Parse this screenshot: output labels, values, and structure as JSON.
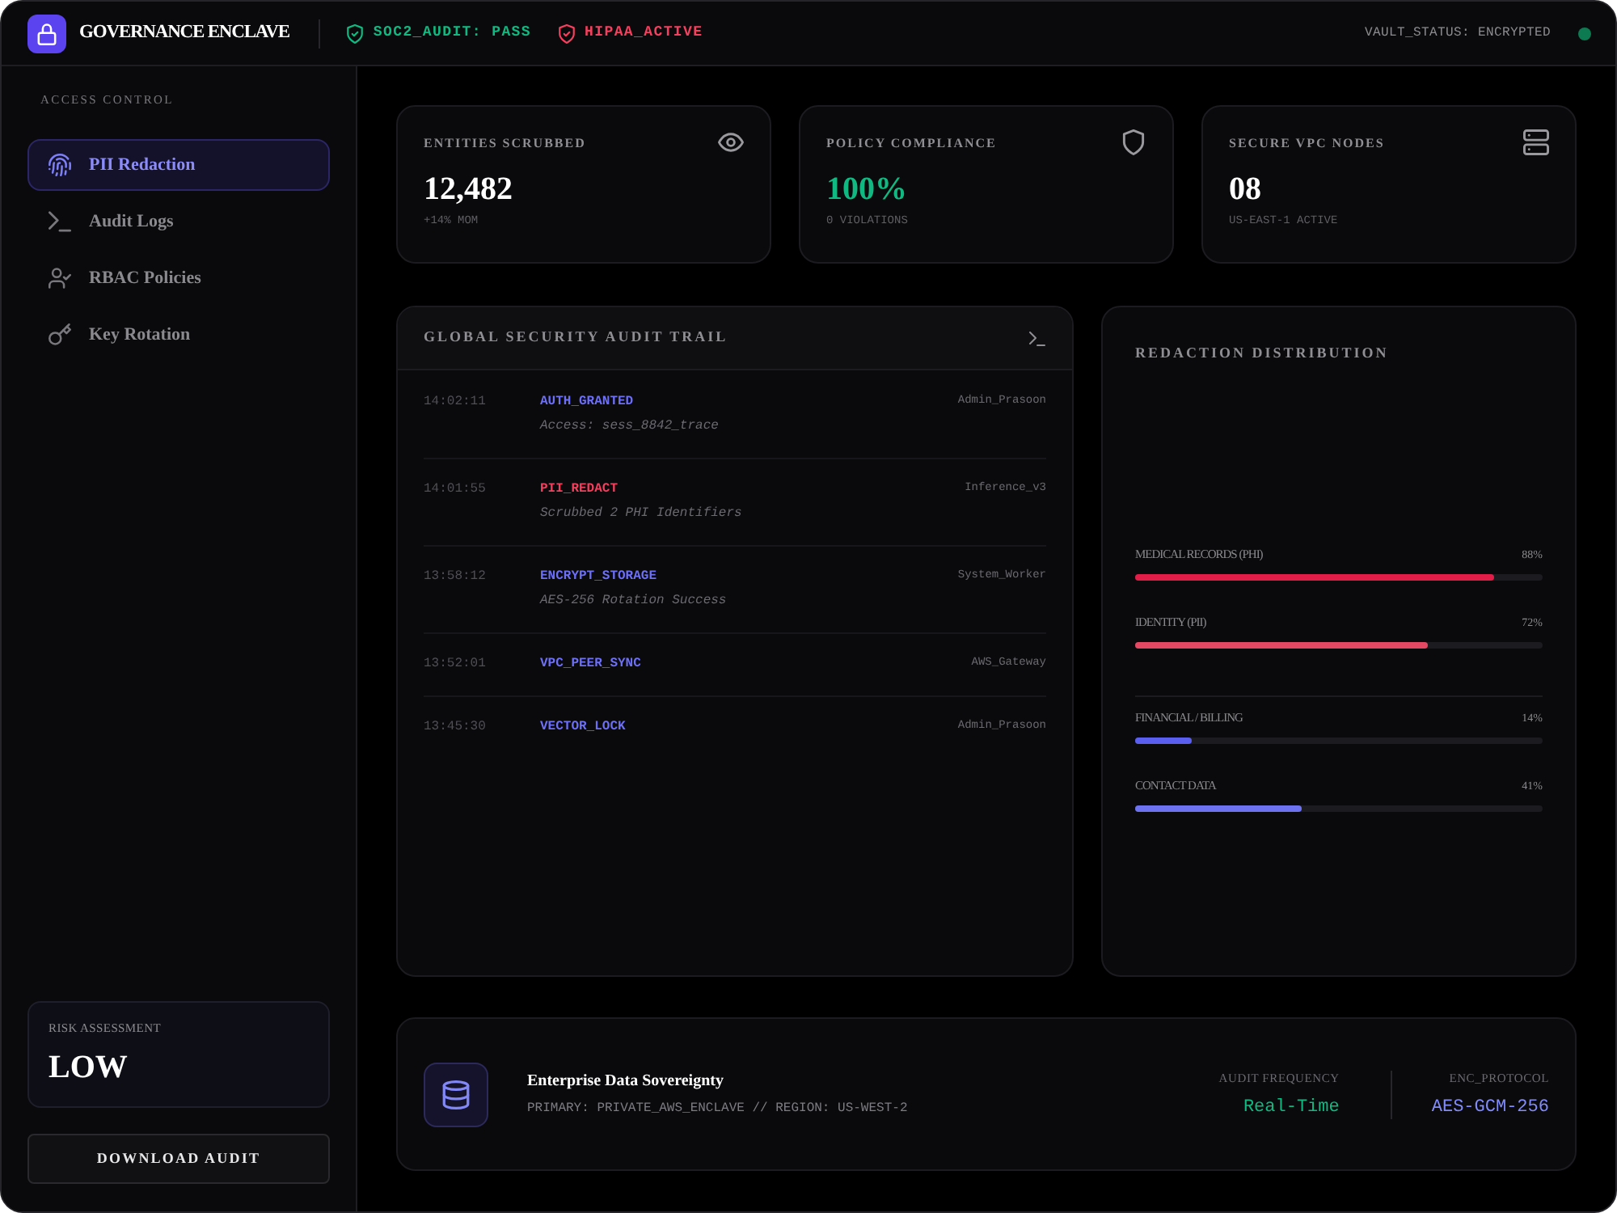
{
  "header": {
    "title": "GOVERNANCE ENCLAVE",
    "badges": [
      {
        "text": "SOC2_AUDIT: PASS",
        "color": "#10b981"
      },
      {
        "text": "HIPAA_ACTIVE",
        "color": "#f43f5e"
      }
    ],
    "vault": {
      "text": "VAULT_STATUS: ENCRYPTED",
      "online": true
    }
  },
  "sidebar": {
    "section_title": "ACCESS CONTROL",
    "items": [
      {
        "label": "PII Redaction",
        "selected": true
      },
      {
        "label": "Audit Logs",
        "selected": false
      },
      {
        "label": "RBAC Policies",
        "selected": false
      },
      {
        "label": "Key Rotation",
        "selected": false
      }
    ],
    "risk": {
      "label": "RISK ASSESSMENT",
      "value": "LOW"
    },
    "download_button": "DOWNLOAD AUDIT"
  },
  "stats": [
    {
      "label": "ENTITIES SCRUBBED",
      "value": "12,482",
      "note": "+14% MOM",
      "color": "#ffffff"
    },
    {
      "label": "POLICY COMPLIANCE",
      "value": "100%",
      "note": "0 VIOLATIONS",
      "color": "#10b981"
    },
    {
      "label": "SECURE VPC NODES",
      "value": "08",
      "note": "US-EAST-1 ACTIVE",
      "color": "#ffffff"
    }
  ],
  "audit_trail": {
    "title": "GLOBAL SECURITY AUDIT TRAIL",
    "entries": [
      {
        "time": "14:02:11",
        "event": "AUTH_GRANTED",
        "detail": "Access: sess_8842_trace",
        "actor": "Admin_Prasoon",
        "color": "#6d6ff7"
      },
      {
        "time": "14:01:55",
        "event": "PII_REDACT",
        "detail": "Scrubbed 2 PHI Identifiers",
        "actor": "Inference_v3",
        "color": "#f43f5e"
      },
      {
        "time": "13:58:12",
        "event": "ENCRYPT_STORAGE",
        "detail": "AES-256 Rotation Success",
        "actor": "System_Worker",
        "color": "#6d6ff7"
      },
      {
        "time": "13:52:01",
        "event": "VPC_PEER_SYNC",
        "actor": "AWS_Gateway",
        "color": "#6d6ff7"
      },
      {
        "time": "13:45:30",
        "event": "VECTOR_LOCK",
        "actor": "Admin_Prasoon",
        "color": "#6d6ff7"
      }
    ]
  },
  "distribution": {
    "title": "REDACTION DISTRIBUTION",
    "groups": [
      {
        "bars": [
          {
            "label": "MEDICAL RECORDS (PHI)",
            "reading": "88%",
            "level": 0.88,
            "color": "#e11d48"
          },
          {
            "label": "IDENTITY (PII)",
            "reading": "72%",
            "level": 0.72,
            "color": "#e54862"
          }
        ]
      },
      {
        "bars": [
          {
            "label": "FINANCIAL / BILLING",
            "reading": "14%",
            "level": 0.14,
            "color": "#5b5ff0"
          },
          {
            "label": "CONTACT DATA",
            "reading": "41%",
            "level": 0.41,
            "color": "#6d72f0"
          }
        ]
      }
    ]
  },
  "sovereignty": {
    "title": "Enterprise Data Sovereignty",
    "detail": "PRIMARY: PRIVATE_AWS_ENCLAVE // REGION: US-WEST-2",
    "metrics": [
      {
        "label": "AUDIT FREQUENCY",
        "value": "Real-Time",
        "color": "#10b981"
      },
      {
        "label": "ENC_PROTOCOL",
        "value": "AES-GCM-256",
        "color": "#818cf8"
      }
    ]
  }
}
